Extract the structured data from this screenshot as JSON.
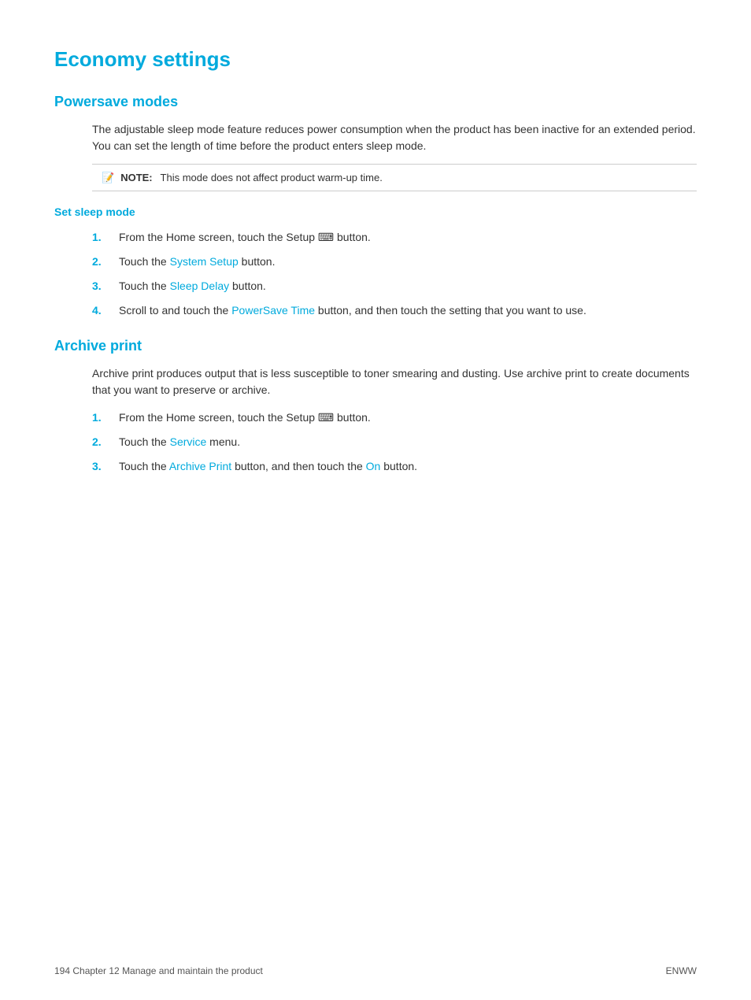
{
  "page": {
    "title": "Economy settings",
    "sections": [
      {
        "id": "powersave",
        "title": "Powersave modes",
        "body": "The adjustable sleep mode feature reduces power consumption when the product has been inactive for an extended period. You can set the length of time before the product enters sleep mode.",
        "note": {
          "label": "NOTE:",
          "text": "This mode does not affect product warm-up time."
        },
        "subsection": {
          "title": "Set sleep mode",
          "steps": [
            {
              "number": "1.",
              "text_before": "From the Home screen, touch the Setup",
              "link": null,
              "text_after": "button.",
              "has_setup_icon": true
            },
            {
              "number": "2.",
              "text_before": "Touch the",
              "link": "System Setup",
              "text_after": "button.",
              "has_setup_icon": false
            },
            {
              "number": "3.",
              "text_before": "Touch the",
              "link": "Sleep Delay",
              "text_after": "button.",
              "has_setup_icon": false
            },
            {
              "number": "4.",
              "text_before": "Scroll to and touch the",
              "link": "PowerSave Time",
              "text_after": "button, and then touch the setting that you want to use.",
              "has_setup_icon": false
            }
          ]
        }
      },
      {
        "id": "archive",
        "title": "Archive print",
        "body": "Archive print produces output that is less susceptible to toner smearing and dusting. Use archive print to create documents that you want to preserve or archive.",
        "steps": [
          {
            "number": "1.",
            "text_before": "From the Home screen, touch the Setup",
            "link": null,
            "text_after": "button.",
            "has_setup_icon": true
          },
          {
            "number": "2.",
            "text_before": "Touch the",
            "link": "Service",
            "text_after": "menu.",
            "has_setup_icon": false
          },
          {
            "number": "3.",
            "text_before": "Touch the",
            "link": "Archive Print",
            "text_after_parts": [
              "button, and then touch the",
              "On",
              "button."
            ],
            "link2": "On",
            "has_setup_icon": false
          }
        ]
      }
    ],
    "footer": {
      "left": "194  Chapter 12   Manage and maintain the product",
      "right": "ENWW"
    }
  }
}
